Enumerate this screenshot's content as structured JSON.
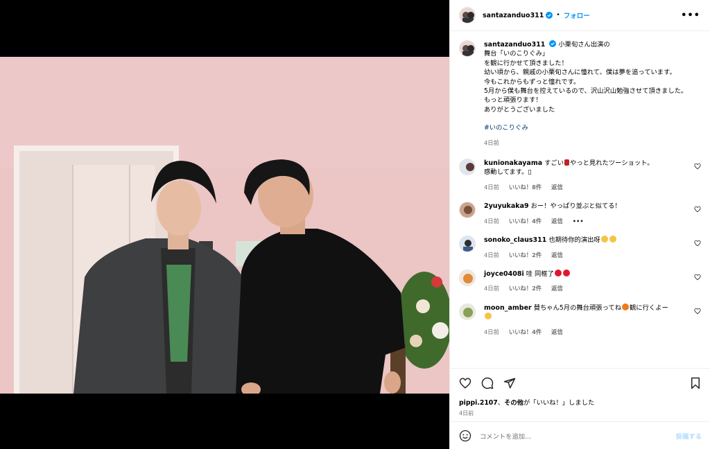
{
  "post": {
    "username": "santazanduo311",
    "dot": "•",
    "follow_label": "フォロー",
    "more_label": "•••",
    "caption_lines": [
      "小栗旬さん出演の",
      "舞台「いのこりぐみ」",
      "を観に行かせて頂きました！",
      "幼い頃から、親戚の小栗旬さんに憧れて、僕は夢を追っています。",
      "今もこれからもずっと憧れです。",
      "5月から僕も舞台を控えているので、沢山沢山勉強させて頂きました。",
      "もっと頑張ります！",
      "ありがとうございました"
    ],
    "hashtag": "#いのこりぐみ",
    "caption_time": "4日前"
  },
  "comments": [
    {
      "user": "kunionakayama",
      "text_a": "すごい",
      "text_b": "やっと見れたツーショット。",
      "text_c": "感動してます。▯",
      "time": "4日前",
      "likes": "いいね！8件",
      "reply": "返信"
    },
    {
      "user": "2yuyukaka9",
      "text": "おー！やっぱり並ぶと似てる！",
      "time": "4日前",
      "likes": "いいね！4件",
      "reply": "返信",
      "more": "•••"
    },
    {
      "user": "sonoko_claus311",
      "text": "也期待你的演出呀",
      "time": "4日前",
      "likes": "いいね！2件",
      "reply": "返信"
    },
    {
      "user": "joyce0408i",
      "text": "哇 同框了",
      "time": "4日前",
      "likes": "いいね！2件",
      "reply": "返信"
    },
    {
      "user": "moon_amber",
      "text_a": "賛ちゃん5月の舞台頑張ってね",
      "text_b": "観に行くよー",
      "time": "4日前",
      "likes": "いいね！4件",
      "reply": "返信"
    }
  ],
  "footer": {
    "liker": "pippi.2107",
    "liked_suffix_a": "、",
    "liked_others": "その他",
    "liked_suffix_b": "が「いいね！」しました",
    "date": "4日前",
    "comment_placeholder": "コメントを追加...",
    "post_label": "投稿する"
  },
  "colors": {
    "accent": "#0095f6",
    "meta": "#737373",
    "wall": "#ecc5c5"
  }
}
